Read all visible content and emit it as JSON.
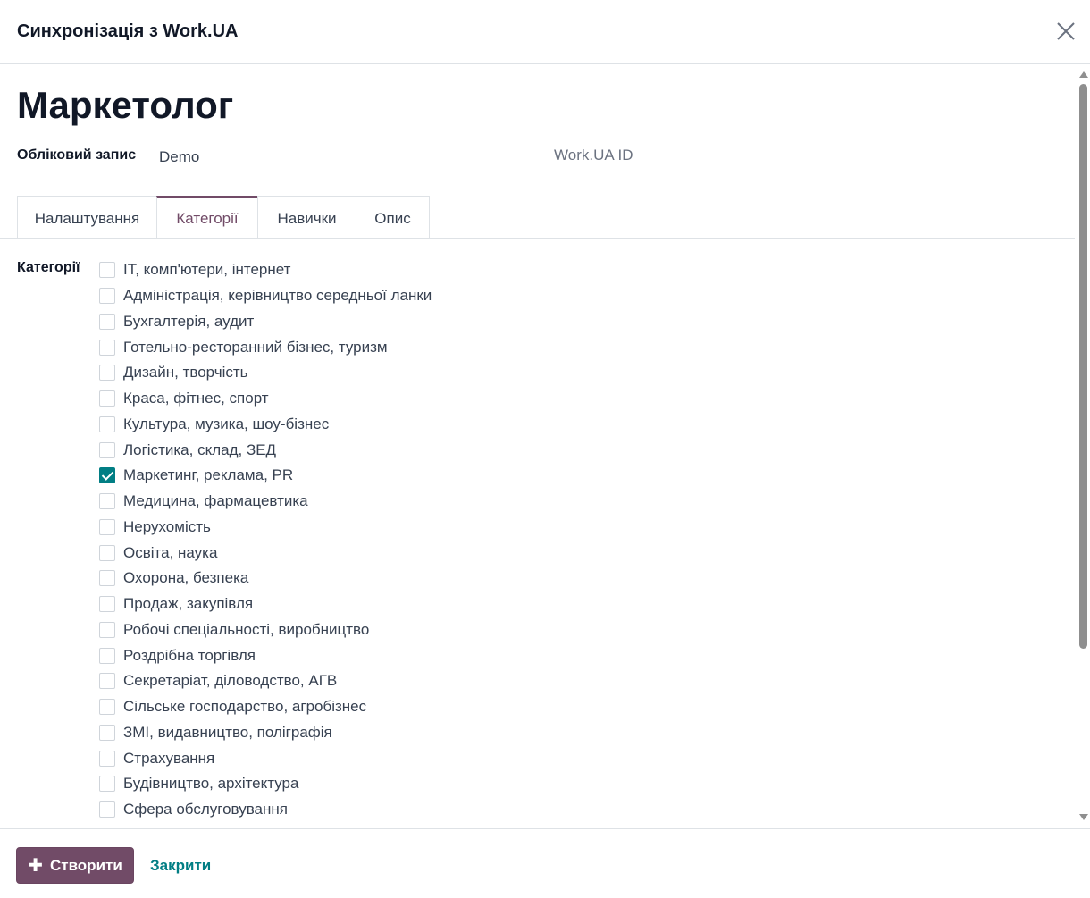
{
  "dialog": {
    "title": "Синхронізація з Work.UA"
  },
  "record": {
    "name": "Маркетолог",
    "account_label": "Обліковий запис",
    "account_value": "Demo",
    "workua_id_label": "Work.UA ID"
  },
  "tabs": [
    {
      "label": "Налаштування",
      "active": false
    },
    {
      "label": "Категорії",
      "active": true
    },
    {
      "label": "Навички",
      "active": false
    },
    {
      "label": "Опис",
      "active": false
    }
  ],
  "categories": {
    "label": "Категорії",
    "items": [
      {
        "label": "IT, комп'ютери, інтернет",
        "checked": false
      },
      {
        "label": "Адміністрація, керівництво середньої ланки",
        "checked": false
      },
      {
        "label": "Бухгалтерія, аудит",
        "checked": false
      },
      {
        "label": "Готельно-ресторанний бізнес, туризм",
        "checked": false
      },
      {
        "label": "Дизайн, творчість",
        "checked": false
      },
      {
        "label": "Краса, фітнес, спорт",
        "checked": false
      },
      {
        "label": "Культура, музика, шоу-бізнес",
        "checked": false
      },
      {
        "label": "Логістика, склад, ЗЕД",
        "checked": false
      },
      {
        "label": "Маркетинг, реклама, PR",
        "checked": true
      },
      {
        "label": "Медицина, фармацевтика",
        "checked": false
      },
      {
        "label": "Нерухомість",
        "checked": false
      },
      {
        "label": "Освіта, наука",
        "checked": false
      },
      {
        "label": "Охорона, безпека",
        "checked": false
      },
      {
        "label": "Продаж, закупівля",
        "checked": false
      },
      {
        "label": "Робочі спеціальності, виробництво",
        "checked": false
      },
      {
        "label": "Роздрібна торгівля",
        "checked": false
      },
      {
        "label": "Секретаріат, діловодство, АГВ",
        "checked": false
      },
      {
        "label": "Сільське господарство, агробізнес",
        "checked": false
      },
      {
        "label": "ЗМІ, видавництво, поліграфія",
        "checked": false
      },
      {
        "label": "Страхування",
        "checked": false
      },
      {
        "label": "Будівництво, архітектура",
        "checked": false
      },
      {
        "label": "Сфера обслуговування",
        "checked": false
      }
    ]
  },
  "footer": {
    "create_label": "Створити",
    "close_label": "Закрити"
  },
  "colors": {
    "brand": "#714b67",
    "accent": "#017e84"
  }
}
